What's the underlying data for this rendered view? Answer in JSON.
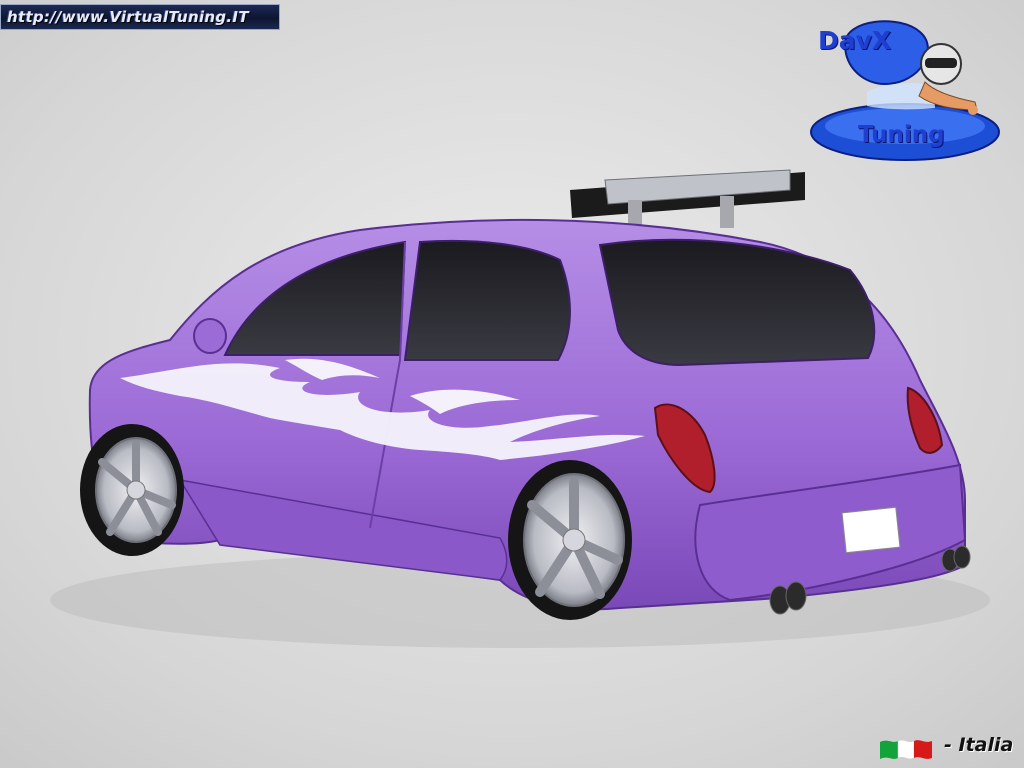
{
  "watermark": {
    "url": "http://www.VirtualTuning.IT"
  },
  "logo": {
    "top_text": "DavX",
    "bottom_text": "Tuning"
  },
  "footer": {
    "country_label": "- Italia"
  },
  "colors": {
    "background": "#d9d9d9",
    "car_body": "#a374d8",
    "car_body_dark": "#7b4db8",
    "flames": "#f4f1fa",
    "logo_blue": "#1f3fd0",
    "flag_green": "#12a33a",
    "flag_white": "#ffffff",
    "flag_red": "#d61a1a"
  },
  "icons": [
    "helmet-icon",
    "italian-flag-icon",
    "rear-spoiler"
  ]
}
